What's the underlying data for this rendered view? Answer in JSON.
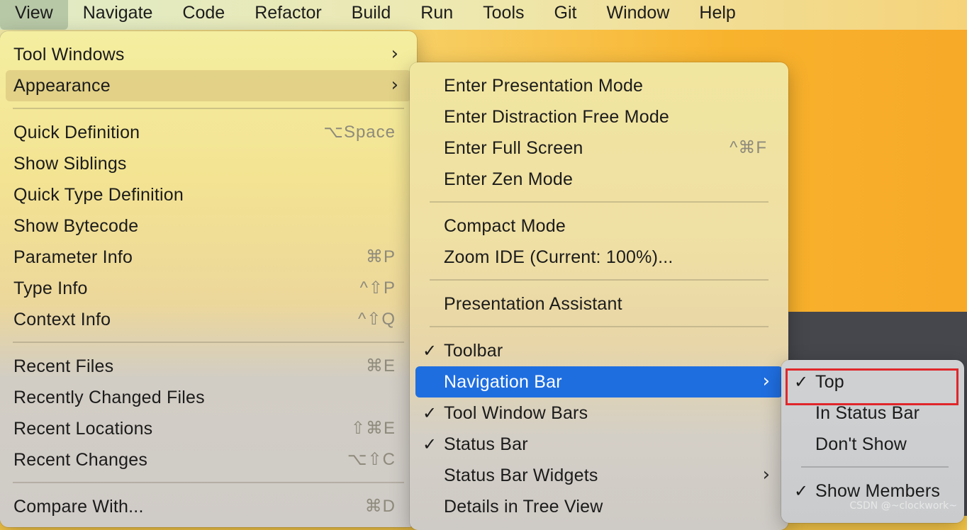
{
  "menubar": {
    "items": [
      {
        "label": "View"
      },
      {
        "label": "Navigate"
      },
      {
        "label": "Code"
      },
      {
        "label": "Refactor"
      },
      {
        "label": "Build"
      },
      {
        "label": "Run"
      },
      {
        "label": "Tools"
      },
      {
        "label": "Git"
      },
      {
        "label": "Window"
      },
      {
        "label": "Help"
      }
    ],
    "active": "View"
  },
  "view_menu": {
    "items": [
      {
        "label": "Tool Windows",
        "submenu": true
      },
      {
        "label": "Appearance",
        "submenu": true,
        "highlighted": true
      },
      {
        "label": "Quick Definition",
        "shortcut": "⌥Space"
      },
      {
        "label": "Show Siblings"
      },
      {
        "label": "Quick Type Definition"
      },
      {
        "label": "Show Bytecode"
      },
      {
        "label": "Parameter Info",
        "shortcut": "⌘P"
      },
      {
        "label": "Type Info",
        "shortcut": "^⇧P"
      },
      {
        "label": "Context Info",
        "shortcut": "^⇧Q"
      },
      {
        "label": "Recent Files",
        "shortcut": "⌘E"
      },
      {
        "label": "Recently Changed Files"
      },
      {
        "label": "Recent Locations",
        "shortcut": "⇧⌘E"
      },
      {
        "label": "Recent Changes",
        "shortcut": "⌥⇧C"
      },
      {
        "label": "Compare With...",
        "shortcut": "⌘D"
      }
    ]
  },
  "appearance_menu": {
    "items": [
      {
        "label": "Enter Presentation Mode"
      },
      {
        "label": "Enter Distraction Free Mode"
      },
      {
        "label": "Enter Full Screen",
        "shortcut": "^⌘F"
      },
      {
        "label": "Enter Zen Mode"
      },
      {
        "label": "Compact Mode"
      },
      {
        "label": "Zoom IDE (Current: 100%)..."
      },
      {
        "label": "Presentation Assistant"
      },
      {
        "label": "Toolbar",
        "checked": true
      },
      {
        "label": "Navigation Bar",
        "submenu": true,
        "highlighted": true
      },
      {
        "label": "Tool Window Bars",
        "checked": true
      },
      {
        "label": "Status Bar",
        "checked": true
      },
      {
        "label": "Status Bar Widgets",
        "submenu": true
      },
      {
        "label": "Details in Tree View"
      }
    ]
  },
  "navigation_bar_menu": {
    "items": [
      {
        "label": "Top",
        "checked": true
      },
      {
        "label": "In Status Bar"
      },
      {
        "label": "Don't Show"
      },
      {
        "label": "Show Members",
        "checked": true
      }
    ]
  },
  "glyphs": {
    "check": "✓",
    "arrow": "›"
  },
  "watermark": "CSDN @~clockwork~",
  "colors": {
    "highlight_blue": "#1f6ee0",
    "annotation_red": "#e0262a"
  }
}
